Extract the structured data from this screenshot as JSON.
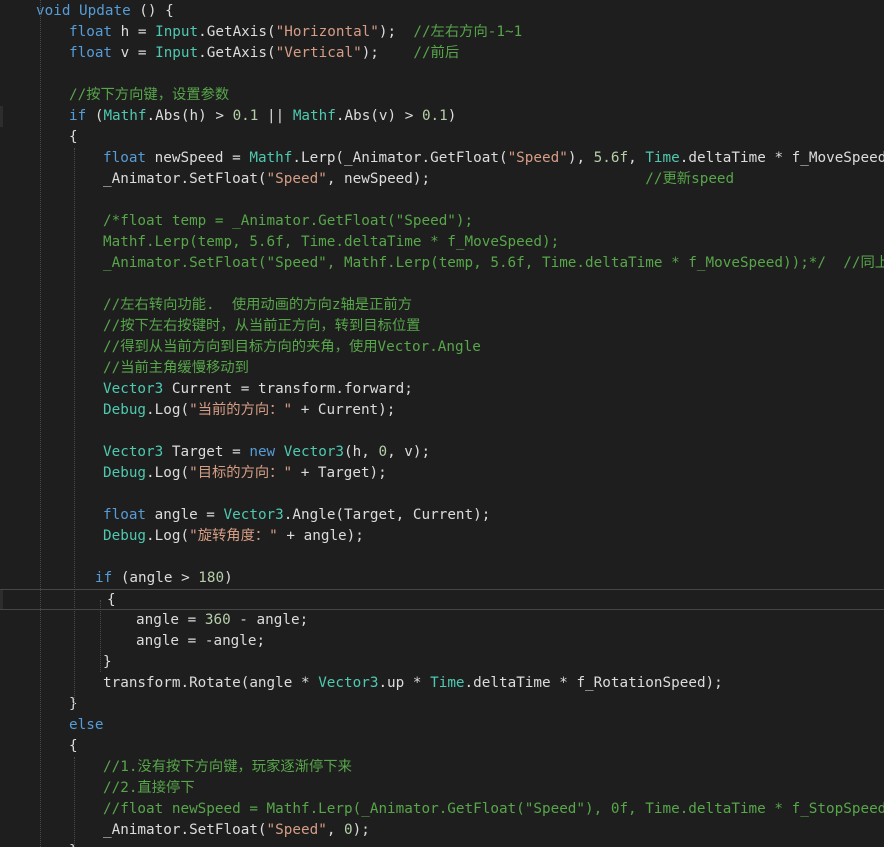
{
  "editor": {
    "language": "C#",
    "theme_colors": {
      "background": "#1e1e1e",
      "keyword": "#569cd6",
      "type": "#4ec9b0",
      "string": "#d69d85",
      "comment": "#57a64a",
      "number": "#b5cea8",
      "text": "#dcdcdc"
    },
    "lines": [
      {
        "tokens": [
          [
            "kw",
            "void"
          ],
          [
            "tx",
            " "
          ],
          [
            "kw",
            "Update"
          ],
          [
            "tx",
            " () {"
          ]
        ]
      },
      {
        "tokens": [
          [
            "kw",
            "float"
          ],
          [
            "tx",
            " h = "
          ],
          [
            "ty",
            "Input"
          ],
          [
            "tx",
            ".GetAxis("
          ],
          [
            "st",
            "\"Horizontal\""
          ],
          [
            "tx",
            ");  "
          ],
          [
            "cm",
            "//左右方向-1~1"
          ]
        ]
      },
      {
        "tokens": [
          [
            "kw",
            "float"
          ],
          [
            "tx",
            " v = "
          ],
          [
            "ty",
            "Input"
          ],
          [
            "tx",
            ".GetAxis("
          ],
          [
            "st",
            "\"Vertical\""
          ],
          [
            "tx",
            ");    "
          ],
          [
            "cm",
            "//前后"
          ]
        ]
      },
      {
        "tokens": []
      },
      {
        "tokens": [
          [
            "cm",
            "//按下方向键，设置参数"
          ]
        ]
      },
      {
        "tokens": [
          [
            "kw",
            "if"
          ],
          [
            "tx",
            " ("
          ],
          [
            "ty",
            "Mathf"
          ],
          [
            "tx",
            ".Abs(h) > "
          ],
          [
            "nu",
            "0.1"
          ],
          [
            "tx",
            " || "
          ],
          [
            "ty",
            "Mathf"
          ],
          [
            "tx",
            ".Abs(v) > "
          ],
          [
            "nu",
            "0.1"
          ],
          [
            "tx",
            ")"
          ]
        ]
      },
      {
        "tokens": [
          [
            "tx",
            "{"
          ]
        ]
      },
      {
        "tokens": [
          [
            "kw",
            "float"
          ],
          [
            "tx",
            " newSpeed = "
          ],
          [
            "ty",
            "Mathf"
          ],
          [
            "tx",
            ".Lerp(_Animator.GetFloat("
          ],
          [
            "st",
            "\"Speed\""
          ],
          [
            "tx",
            "), "
          ],
          [
            "nu",
            "5.6f"
          ],
          [
            "tx",
            ", "
          ],
          [
            "ty",
            "Time"
          ],
          [
            "tx",
            ".deltaTime * f_MoveSpeed);"
          ]
        ]
      },
      {
        "tokens": [
          [
            "tx",
            "_Animator.SetFloat("
          ],
          [
            "st",
            "\"Speed\""
          ],
          [
            "tx",
            ", newSpeed);                         "
          ],
          [
            "cm",
            "//更新speed"
          ]
        ]
      },
      {
        "tokens": []
      },
      {
        "tokens": [
          [
            "cm",
            "/*float temp = _Animator.GetFloat(\"Speed\");"
          ]
        ]
      },
      {
        "tokens": [
          [
            "cm",
            "Mathf.Lerp(temp, 5.6f, Time.deltaTime * f_MoveSpeed);"
          ]
        ]
      },
      {
        "tokens": [
          [
            "cm",
            "_Animator.SetFloat(\"Speed\", Mathf.Lerp(temp, 5.6f, Time.deltaTime * f_MoveSpeed));*/  //同上功能"
          ]
        ]
      },
      {
        "tokens": []
      },
      {
        "tokens": [
          [
            "cm",
            "//左右转向功能.  使用动画的方向z轴是正前方"
          ]
        ]
      },
      {
        "tokens": [
          [
            "cm",
            "//按下左右按键时，从当前正方向，转到目标位置"
          ]
        ]
      },
      {
        "tokens": [
          [
            "cm",
            "//得到从当前方向到目标方向的夹角，使用Vector.Angle"
          ]
        ]
      },
      {
        "tokens": [
          [
            "cm",
            "//当前主角缓慢移动到"
          ]
        ]
      },
      {
        "tokens": [
          [
            "ty",
            "Vector3"
          ],
          [
            "tx",
            " Current = transform.forward;"
          ]
        ]
      },
      {
        "tokens": [
          [
            "ty",
            "Debug"
          ],
          [
            "tx",
            ".Log("
          ],
          [
            "st",
            "\"当前的方向：\""
          ],
          [
            "tx",
            " + Current);"
          ]
        ]
      },
      {
        "tokens": []
      },
      {
        "tokens": [
          [
            "ty",
            "Vector3"
          ],
          [
            "tx",
            " Target = "
          ],
          [
            "kw",
            "new"
          ],
          [
            "tx",
            " "
          ],
          [
            "ty",
            "Vector3"
          ],
          [
            "tx",
            "(h, "
          ],
          [
            "nu",
            "0"
          ],
          [
            "tx",
            ", v);"
          ]
        ]
      },
      {
        "tokens": [
          [
            "ty",
            "Debug"
          ],
          [
            "tx",
            ".Log("
          ],
          [
            "st",
            "\"目标的方向：\""
          ],
          [
            "tx",
            " + Target);"
          ]
        ]
      },
      {
        "tokens": []
      },
      {
        "tokens": [
          [
            "kw",
            "float"
          ],
          [
            "tx",
            " angle = "
          ],
          [
            "ty",
            "Vector3"
          ],
          [
            "tx",
            ".Angle(Target, Current);"
          ]
        ]
      },
      {
        "tokens": [
          [
            "ty",
            "Debug"
          ],
          [
            "tx",
            ".Log("
          ],
          [
            "st",
            "\"旋转角度：\""
          ],
          [
            "tx",
            " + angle);"
          ]
        ]
      },
      {
        "tokens": []
      },
      {
        "tokens": [
          [
            "kw",
            "if"
          ],
          [
            "tx",
            " (angle > "
          ],
          [
            "nu",
            "180"
          ],
          [
            "tx",
            ")"
          ]
        ]
      },
      {
        "tokens": [
          [
            "tx",
            "{"
          ]
        ]
      },
      {
        "tokens": [
          [
            "tx",
            "angle = "
          ],
          [
            "nu",
            "360"
          ],
          [
            "tx",
            " - angle;"
          ]
        ]
      },
      {
        "tokens": [
          [
            "tx",
            "angle = -angle;"
          ]
        ]
      },
      {
        "tokens": [
          [
            "tx",
            "}"
          ]
        ]
      },
      {
        "tokens": [
          [
            "tx",
            "transform.Rotate(angle * "
          ],
          [
            "ty",
            "Vector3"
          ],
          [
            "tx",
            ".up * "
          ],
          [
            "ty",
            "Time"
          ],
          [
            "tx",
            ".deltaTime * f_RotationSpeed);"
          ]
        ]
      },
      {
        "tokens": [
          [
            "tx",
            "}"
          ]
        ]
      },
      {
        "tokens": [
          [
            "kw",
            "else"
          ]
        ]
      },
      {
        "tokens": [
          [
            "tx",
            "{"
          ]
        ]
      },
      {
        "tokens": [
          [
            "cm",
            "//1.没有按下方向键，玩家逐渐停下来"
          ]
        ]
      },
      {
        "tokens": [
          [
            "cm",
            "//2.直接停下"
          ]
        ]
      },
      {
        "tokens": [
          [
            "cm",
            "//float newSpeed = Mathf.Lerp(_Animator.GetFloat(\"Speed\"), 0f, Time.deltaTime * f_StopSpeed);"
          ]
        ]
      },
      {
        "tokens": [
          [
            "tx",
            "_Animator.SetFloat("
          ],
          [
            "st",
            "\"Speed\""
          ],
          [
            "tx",
            ", "
          ],
          [
            "nu",
            "0"
          ],
          [
            "tx",
            ");"
          ]
        ]
      },
      {
        "tokens": [
          [
            "tx",
            "}"
          ]
        ]
      }
    ]
  }
}
